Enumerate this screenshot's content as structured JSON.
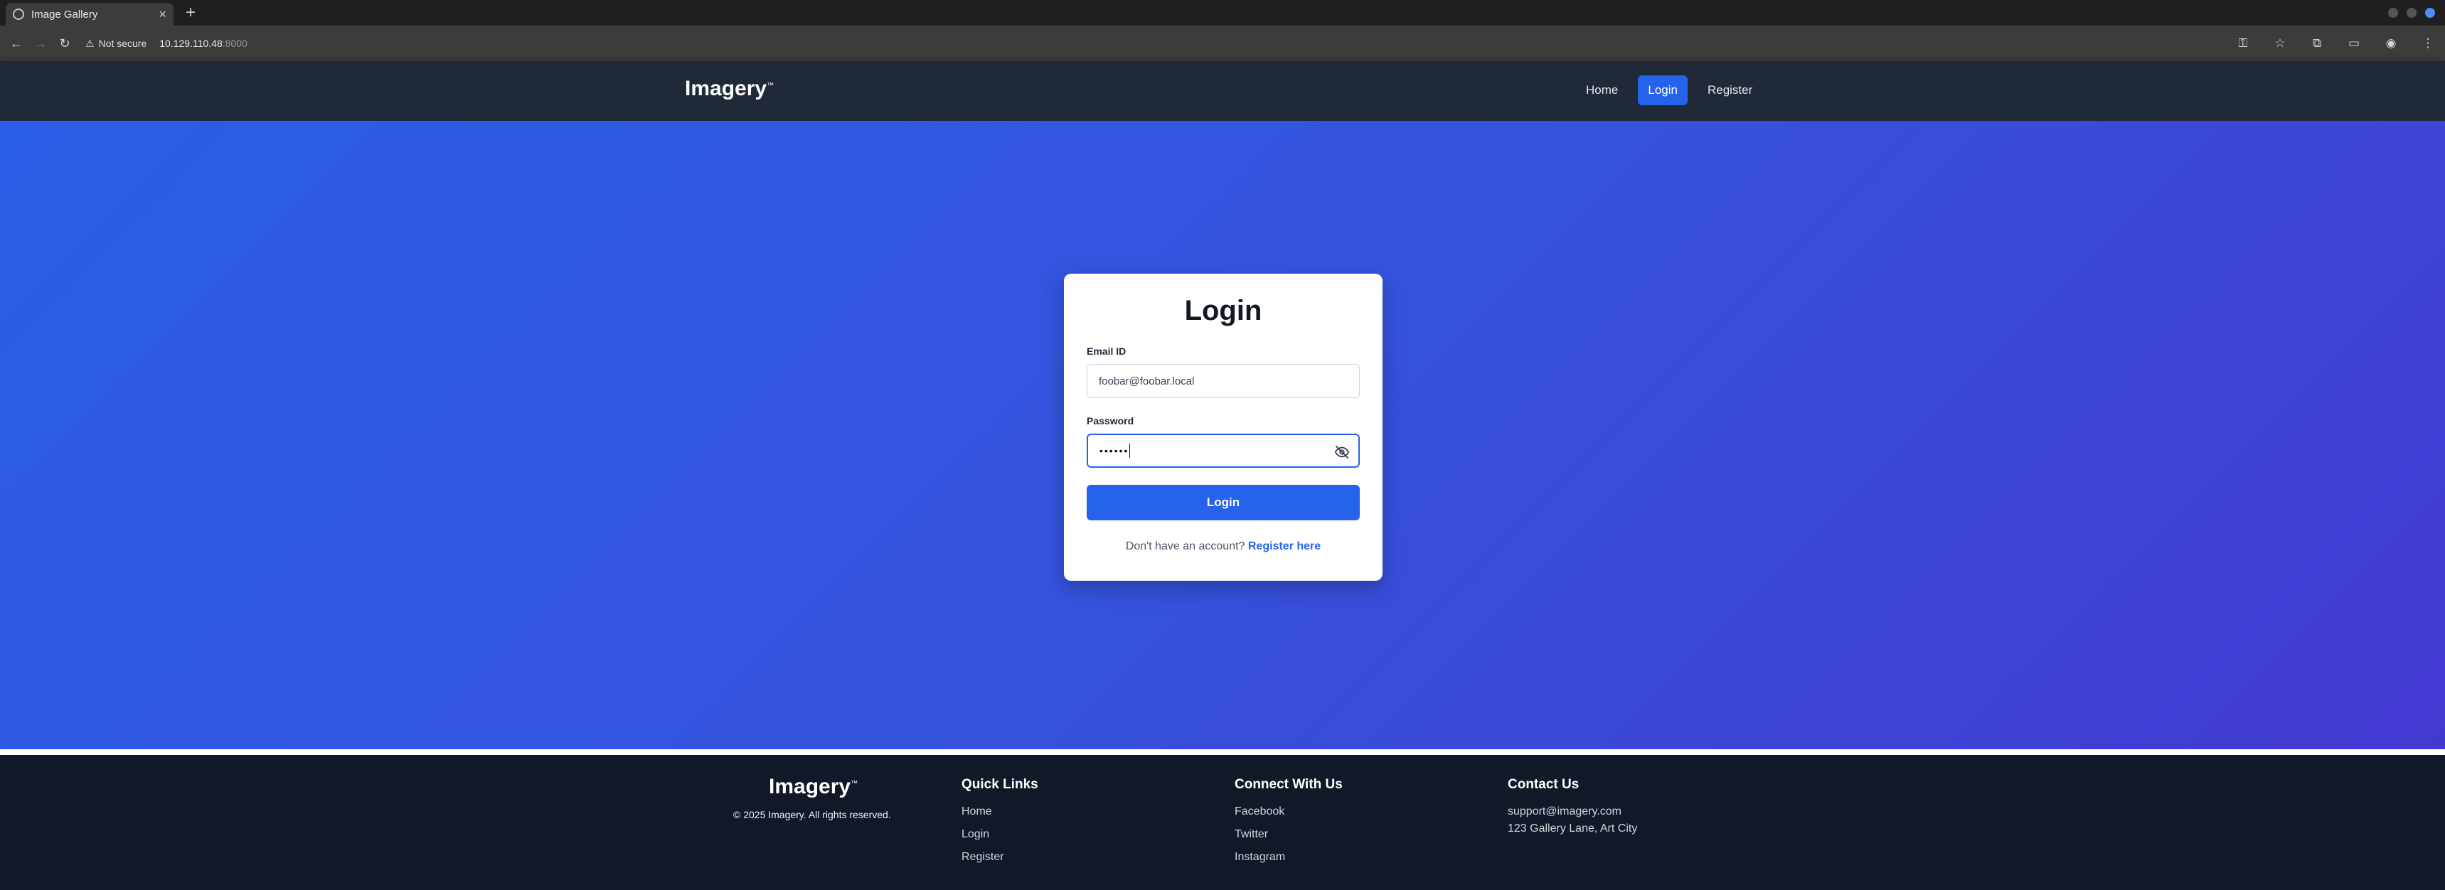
{
  "browser": {
    "tab_title": "Image Gallery",
    "security_label": "Not secure",
    "url_host": "10.129.110.48",
    "url_port": ":8000"
  },
  "nav": {
    "brand": "Imagery",
    "brand_mark": "™",
    "links": [
      {
        "label": "Home"
      },
      {
        "label": "Login",
        "active": true
      },
      {
        "label": "Register"
      }
    ]
  },
  "login": {
    "title": "Login",
    "email_label": "Email ID",
    "email_value": "foobar@foobar.local",
    "password_label": "Password",
    "password_masked": "••••••",
    "submit_label": "Login",
    "signup_prompt": "Don't have an account?",
    "signup_link": "Register here"
  },
  "footer": {
    "brand": "Imagery",
    "brand_mark": "™",
    "copyright": "© 2025 Imagery. All rights reserved.",
    "quick_links": {
      "heading": "Quick Links",
      "items": [
        "Home",
        "Login",
        "Register"
      ]
    },
    "social": {
      "heading": "Connect With Us",
      "items": [
        "Facebook",
        "Twitter",
        "Instagram"
      ]
    },
    "contact": {
      "heading": "Contact Us",
      "email": "support@imagery.com",
      "address": "123 Gallery Lane, Art City"
    }
  },
  "colors": {
    "accent": "#2563eb",
    "navbar": "#1f2937",
    "footer": "#111827",
    "hero_start": "#2b5ee8",
    "hero_end": "#4339d1"
  }
}
